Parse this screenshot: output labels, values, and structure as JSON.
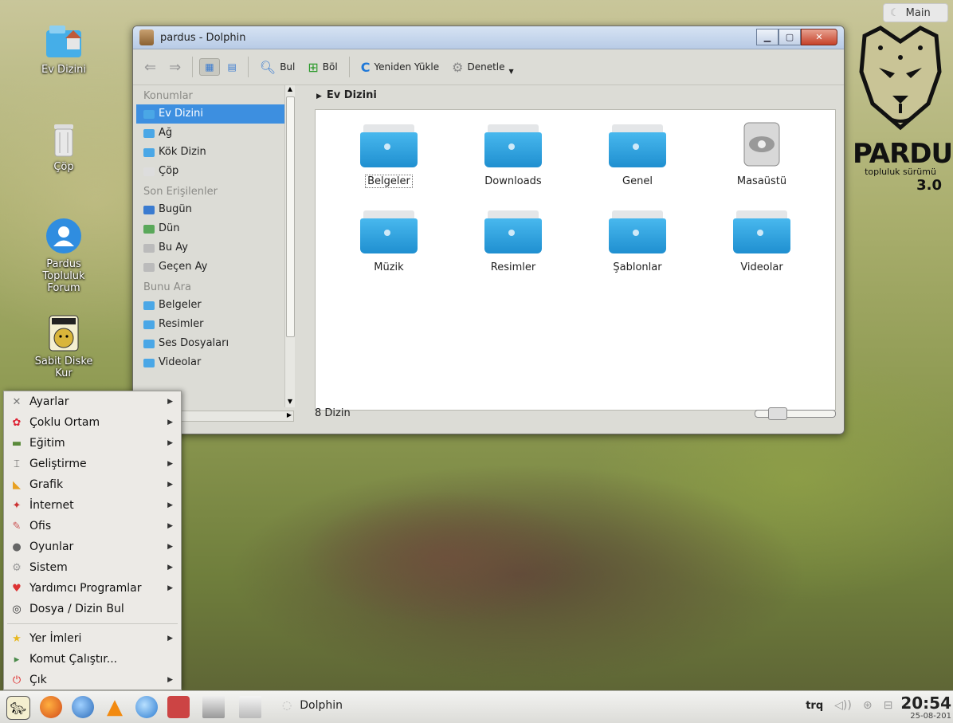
{
  "desktop": {
    "icons": [
      {
        "label": "Ev Dizini"
      },
      {
        "label": "Çöp"
      },
      {
        "label": "Pardus Topluluk Forum"
      },
      {
        "label": "Sabit Diske Kur"
      }
    ],
    "main_applet": "Main",
    "logo": {
      "word": "PARDUS",
      "sub": "topluluk sürümü",
      "version": "3.0"
    }
  },
  "window": {
    "title": "pardus - Dolphin",
    "toolbar": {
      "find": "Bul",
      "split": "Böl",
      "reload": "Yeniden Yükle",
      "control": "Denetle"
    },
    "places": {
      "section1": "Konumlar",
      "items1": [
        {
          "label": "Ev Dizini"
        },
        {
          "label": "Ağ"
        },
        {
          "label": "Kök Dizin"
        },
        {
          "label": "Çöp"
        }
      ],
      "section2": "Son Erişilenler",
      "items2": [
        {
          "label": "Bugün"
        },
        {
          "label": "Dün"
        },
        {
          "label": "Bu Ay"
        },
        {
          "label": "Geçen Ay"
        }
      ],
      "section3": "Bunu Ara",
      "items3": [
        {
          "label": "Belgeler"
        },
        {
          "label": "Resimler"
        },
        {
          "label": "Ses Dosyaları"
        },
        {
          "label": "Videolar"
        }
      ]
    },
    "breadcrumb": "Ev Dizini",
    "files": [
      {
        "name": "Belgeler"
      },
      {
        "name": "Downloads"
      },
      {
        "name": "Genel"
      },
      {
        "name": "Masaüstü"
      },
      {
        "name": "Müzik"
      },
      {
        "name": "Resimler"
      },
      {
        "name": "Şablonlar"
      },
      {
        "name": "Videolar"
      }
    ],
    "status": "8 Dizin"
  },
  "menu": {
    "items": [
      {
        "label": "Ayarlar"
      },
      {
        "label": "Çoklu Ortam"
      },
      {
        "label": "Eğitim"
      },
      {
        "label": "Geliştirme"
      },
      {
        "label": "Grafik"
      },
      {
        "label": "İnternet"
      },
      {
        "label": "Ofis"
      },
      {
        "label": "Oyunlar"
      },
      {
        "label": "Sistem"
      },
      {
        "label": "Yardımcı Programlar"
      },
      {
        "label": "Dosya / Dizin Bul"
      },
      {
        "label": "Yer İmleri"
      },
      {
        "label": "Komut Çalıştır..."
      },
      {
        "label": "Çık"
      }
    ]
  },
  "taskbar": {
    "task": "Dolphin",
    "lang": "trq",
    "time": "20:54",
    "date": "25-08-201"
  }
}
